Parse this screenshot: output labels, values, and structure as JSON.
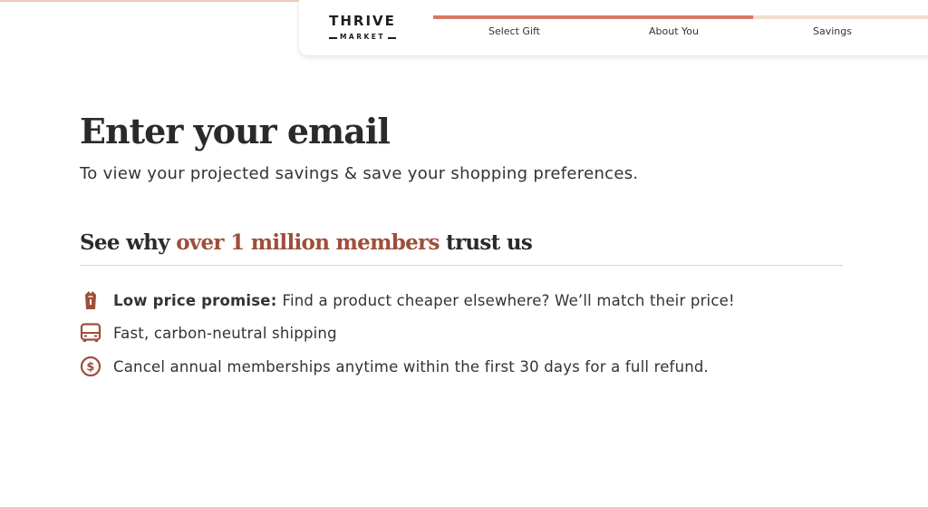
{
  "header": {
    "logo": {
      "top": "THRIVE",
      "bottom": "MARKET"
    },
    "progress": {
      "fraction": 0.63,
      "color": "#d67a63",
      "track_color": "#f1ddd0"
    },
    "steps": [
      {
        "label": "Select Gift"
      },
      {
        "label": "About You"
      },
      {
        "label": "Savings"
      }
    ]
  },
  "main": {
    "title": "Enter your email",
    "subtitle": "To view your projected savings & save your shopping preferences.",
    "trust": {
      "prefix": "See why ",
      "highlight": "over 1 million members",
      "suffix": " trust us",
      "highlight_color": "#9e4e3b"
    },
    "features": [
      {
        "icon": "price-tag-bag-icon",
        "bold": "Low price promise:",
        "text": "Find a product cheaper elsewhere? We’ll match their price!"
      },
      {
        "icon": "delivery-truck-icon",
        "bold": "",
        "text": "Fast, carbon-neutral shipping"
      },
      {
        "icon": "dollar-circle-icon",
        "bold": "",
        "text": "Cancel annual memberships anytime within the first 30 days for a full refund."
      }
    ]
  }
}
